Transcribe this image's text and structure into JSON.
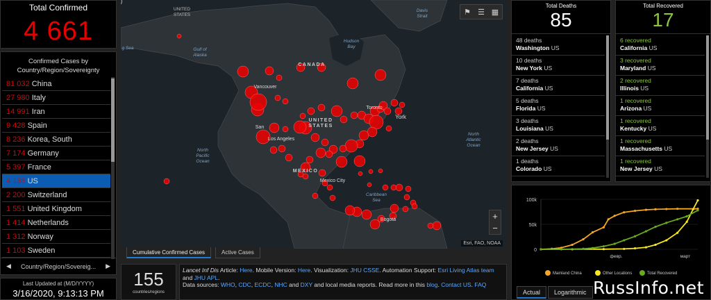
{
  "total_confirmed": {
    "title": "Total Confirmed",
    "value": "4 661"
  },
  "country_list": {
    "title": "Confirmed Cases by Country/Region/Sovereignty",
    "items": [
      {
        "count": "81 032",
        "name": "China"
      },
      {
        "count": "27 980",
        "name": "Italy"
      },
      {
        "count": "14 991",
        "name": "Iran"
      },
      {
        "count": "9 428",
        "name": "Spain"
      },
      {
        "count": "8 236",
        "name": "Korea, South"
      },
      {
        "count": "7 174",
        "name": "Germany"
      },
      {
        "count": "5 397",
        "name": "France"
      },
      {
        "count": "4 138",
        "name": "US"
      },
      {
        "count": "2 200",
        "name": "Switzerland"
      },
      {
        "count": "1 551",
        "name": "United Kingdom"
      },
      {
        "count": "1 414",
        "name": "Netherlands"
      },
      {
        "count": "1 312",
        "name": "Norway"
      },
      {
        "count": "1 103",
        "name": "Sweden"
      }
    ],
    "selected_index": 7,
    "footer_label": "Country/Region/Sovereig..."
  },
  "last_updated": {
    "label": "Last Updated at (M/D/YYYY)",
    "value": "3/16/2020, 9:13:13 PM"
  },
  "map": {
    "labels": {
      "united_states": "UNITED\nSTATES",
      "davis_strait": "Davis\nStrait",
      "gulf_of_alaska": "Gulf of\nAlaska",
      "hudson_bay": "Hudson\nBay",
      "canada": "CANADA",
      "vancouver": "Vancouver",
      "toronto": "Toronto",
      "new_york": "York",
      "united_states_map": "UNITED\nSTATES",
      "san_francisco": "San",
      "los_angeles": "Los Angeles",
      "north_pacific_ocean": "North\nPacific\nOcean",
      "north_atlantic_ocean": "North\nAtlantic\nOcean",
      "mexico": "MEXICO",
      "mexico_city": "Mexico City",
      "caribbean_sea": "Caribbean\nSea",
      "bogota": "Bogotá",
      "sea_edge": "g Sea"
    },
    "attribution": "Esri, FAO, NOAA",
    "tabs": [
      "Cumulative Confirmed Cases",
      "Active Cases"
    ],
    "active_tab": 0
  },
  "countries_count": {
    "value": "155",
    "label": "countries/regions"
  },
  "info": {
    "source_prefix": "Lancet Inf Dis",
    "article_label": " Article: ",
    "here1": "Here",
    "mobile_label": ". Mobile Version: ",
    "here2": "Here",
    "viz_label": ". Visualization: ",
    "jhu_csse": "JHU CSSE",
    "automation_label": ". Automation Support: ",
    "esri_team": "Esri Living Atlas team",
    "and1": " and ",
    "jhu_apl": "JHU APL",
    "data_label": ".\nData sources: ",
    "who": "WHO",
    "cdc": "CDC",
    "ecdc": "ECDC",
    "nhc": "NHC",
    "dxy": "DXY",
    "rest": " and local media reports. Read more in this ",
    "blog": "blog",
    "contact": "Contact US",
    "faq": "FAQ"
  },
  "total_deaths": {
    "title": "Total Deaths",
    "value": "85",
    "items": [
      {
        "count": "48 deaths",
        "place": "Washington",
        "country": "US"
      },
      {
        "count": "10 deaths",
        "place": "New York",
        "country": "US"
      },
      {
        "count": "7 deaths",
        "place": "California",
        "country": "US"
      },
      {
        "count": "5 deaths",
        "place": "Florida",
        "country": "US"
      },
      {
        "count": "3 deaths",
        "place": "Louisiana",
        "country": "US"
      },
      {
        "count": "2 deaths",
        "place": "New Jersey",
        "country": "US"
      },
      {
        "count": "1 deaths",
        "place": "Colorado",
        "country": "US"
      }
    ]
  },
  "total_recovered": {
    "title": "Total Recovered",
    "value": "17",
    "items": [
      {
        "count": "6 recovered",
        "place": "California",
        "country": "US"
      },
      {
        "count": "3 recovered",
        "place": "Maryland",
        "country": "US"
      },
      {
        "count": "2 recovered",
        "place": "Illinois",
        "country": "US"
      },
      {
        "count": "1 recovered",
        "place": "Arizona",
        "country": "US"
      },
      {
        "count": "1 recovered",
        "place": "Kentucky",
        "country": "US"
      },
      {
        "count": "1 recovered",
        "place": "Massachusetts",
        "country": "US"
      },
      {
        "count": "1 recovered",
        "place": "New Jersey",
        "country": "US"
      }
    ]
  },
  "chart_tabs": [
    "Actual",
    "Logarithmic",
    ""
  ],
  "watermark": "RussInfo.net",
  "colors": {
    "confirmed_red": "#e60000",
    "recovered_green": "#8cc63f",
    "accent_blue": "#0a5db3",
    "mainland_china": "#f5a623",
    "other_locations": "#f8e71c",
    "total_recovered": "#6aaa1e"
  },
  "chart_data": {
    "type": "line",
    "x_tick_labels": [
      "февр.",
      "март"
    ],
    "y_tick_labels": [
      "0",
      "50k",
      "100k"
    ],
    "ylim": [
      0,
      100000
    ],
    "legend_position": "bottom",
    "series": [
      {
        "name": "Mainland China",
        "color": "#f5a623",
        "points": [
          [
            0,
            0
          ],
          [
            0.07,
            1000
          ],
          [
            0.13,
            3000
          ],
          [
            0.2,
            9000
          ],
          [
            0.27,
            20000
          ],
          [
            0.33,
            34000
          ],
          [
            0.4,
            44000
          ],
          [
            0.43,
            60000
          ],
          [
            0.47,
            67000
          ],
          [
            0.53,
            74000
          ],
          [
            0.6,
            77000
          ],
          [
            0.67,
            79000
          ],
          [
            0.73,
            80000
          ],
          [
            0.8,
            80500
          ],
          [
            0.87,
            81000
          ],
          [
            1,
            81032
          ]
        ]
      },
      {
        "name": "Other Locations",
        "color": "#f8e71c",
        "points": [
          [
            0,
            0
          ],
          [
            0.2,
            100
          ],
          [
            0.4,
            300
          ],
          [
            0.53,
            800
          ],
          [
            0.6,
            2000
          ],
          [
            0.67,
            4000
          ],
          [
            0.73,
            9000
          ],
          [
            0.8,
            18000
          ],
          [
            0.87,
            33000
          ],
          [
            0.93,
            55000
          ],
          [
            0.97,
            80000
          ],
          [
            1,
            98000
          ]
        ]
      },
      {
        "name": "Total Recovered",
        "color": "#6aaa1e",
        "points": [
          [
            0,
            0
          ],
          [
            0.13,
            50
          ],
          [
            0.27,
            1000
          ],
          [
            0.33,
            2500
          ],
          [
            0.4,
            6000
          ],
          [
            0.47,
            11000
          ],
          [
            0.53,
            18000
          ],
          [
            0.6,
            26000
          ],
          [
            0.67,
            36000
          ],
          [
            0.73,
            45000
          ],
          [
            0.8,
            53000
          ],
          [
            0.87,
            60000
          ],
          [
            0.93,
            66000
          ],
          [
            1,
            78000
          ]
        ]
      }
    ]
  }
}
